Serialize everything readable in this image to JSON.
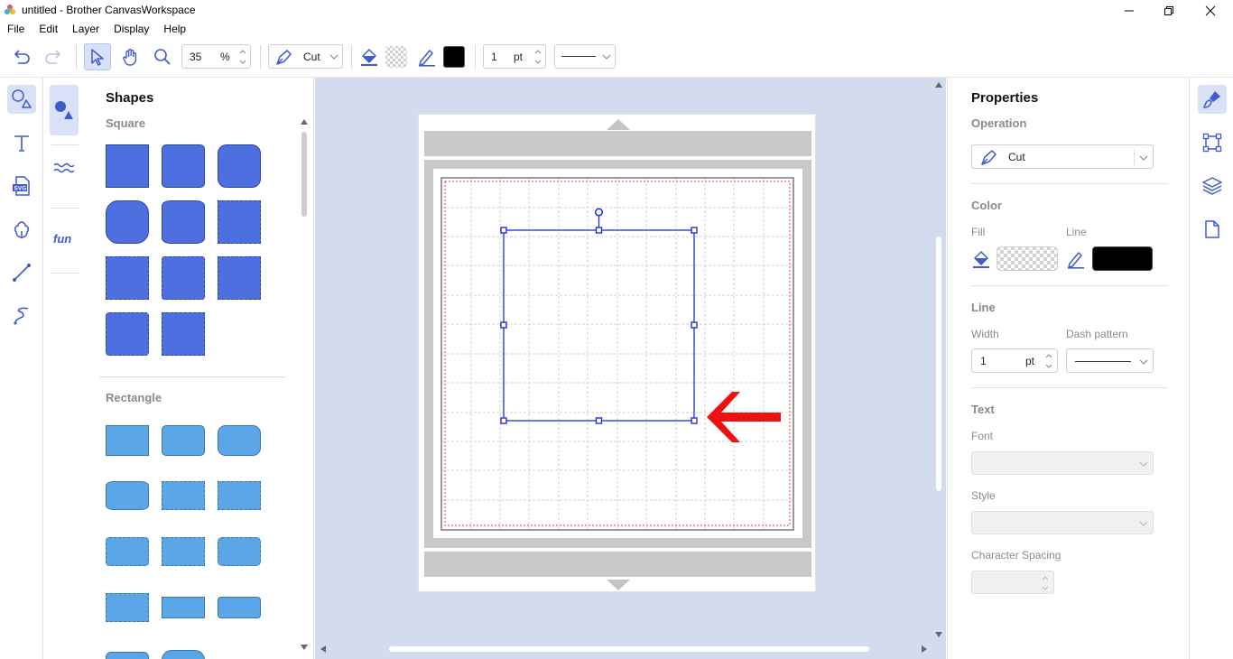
{
  "window": {
    "title": "untitled - Brother CanvasWorkspace"
  },
  "menu": [
    "File",
    "Edit",
    "Layer",
    "Display",
    "Help"
  ],
  "toolbar": {
    "zoom_value": "35",
    "zoom_unit": "%",
    "operation": "Cut",
    "line_width_value": "1",
    "line_width_unit": "pt",
    "line_color": "#000000"
  },
  "shapes_panel": {
    "title": "Shapes",
    "sections": [
      "Square",
      "Rectangle"
    ]
  },
  "properties": {
    "title": "Properties",
    "operation_label": "Operation",
    "operation_value": "Cut",
    "color_label": "Color",
    "fill_label": "Fill",
    "line_label": "Line",
    "line_color": "#000000",
    "line_section": "Line",
    "width_label": "Width",
    "width_value": "1",
    "width_unit": "pt",
    "dash_label": "Dash pattern",
    "text_section": "Text",
    "font_label": "Font",
    "style_label": "Style",
    "char_spacing_label": "Character Spacing"
  },
  "colors": {
    "accent": "#3f5bcc",
    "square_fill": "#4e6fe0",
    "rect_fill": "#5aa6e6",
    "canvas_bg": "#d3dbef",
    "selection": "#1f2fd0",
    "arrow": "#ee1111"
  }
}
